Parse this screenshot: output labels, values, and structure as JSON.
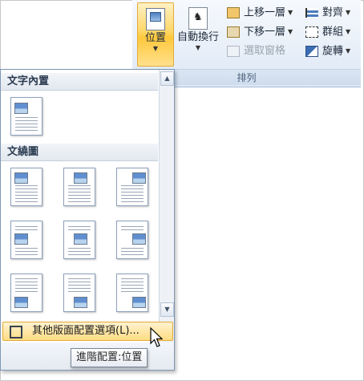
{
  "ribbon": {
    "group_label": "排列",
    "position_button": {
      "label": "位置",
      "icon": "position-icon"
    },
    "wrap_text_button": {
      "label": "自動換行",
      "icon": "wrap-text-icon"
    },
    "bring_forward": {
      "label": "上移一層",
      "icon": "bring-forward-icon"
    },
    "send_backward": {
      "label": "下移一層",
      "icon": "send-backward-icon"
    },
    "selection_pane": {
      "label": "選取窗格",
      "icon": "selection-pane-icon",
      "enabled": false
    },
    "align": {
      "label": "對齊",
      "icon": "align-icon"
    },
    "group": {
      "label": "群組",
      "icon": "group-icon"
    },
    "rotate": {
      "label": "旋轉",
      "icon": "rotate-icon"
    }
  },
  "dropdown": {
    "inline_header": "文字內置",
    "wrap_header": "文繞圖",
    "inline_options": [
      {
        "name": "in-line-with-text"
      }
    ],
    "wrap_options": [
      {
        "name": "top-left"
      },
      {
        "name": "top-center"
      },
      {
        "name": "top-right"
      },
      {
        "name": "middle-left"
      },
      {
        "name": "middle-center"
      },
      {
        "name": "middle-right"
      },
      {
        "name": "bottom-left"
      },
      {
        "name": "bottom-center"
      },
      {
        "name": "bottom-right"
      }
    ],
    "more_options_label": "其他版面配置選項(L)...",
    "more_options_icon": "layout-options-icon"
  },
  "tooltip": {
    "text": "進階配置:位置"
  },
  "colors": {
    "highlight": "#ffd767",
    "highlight_border": "#e3a93a",
    "ribbon_bg": "#dde8f5"
  }
}
